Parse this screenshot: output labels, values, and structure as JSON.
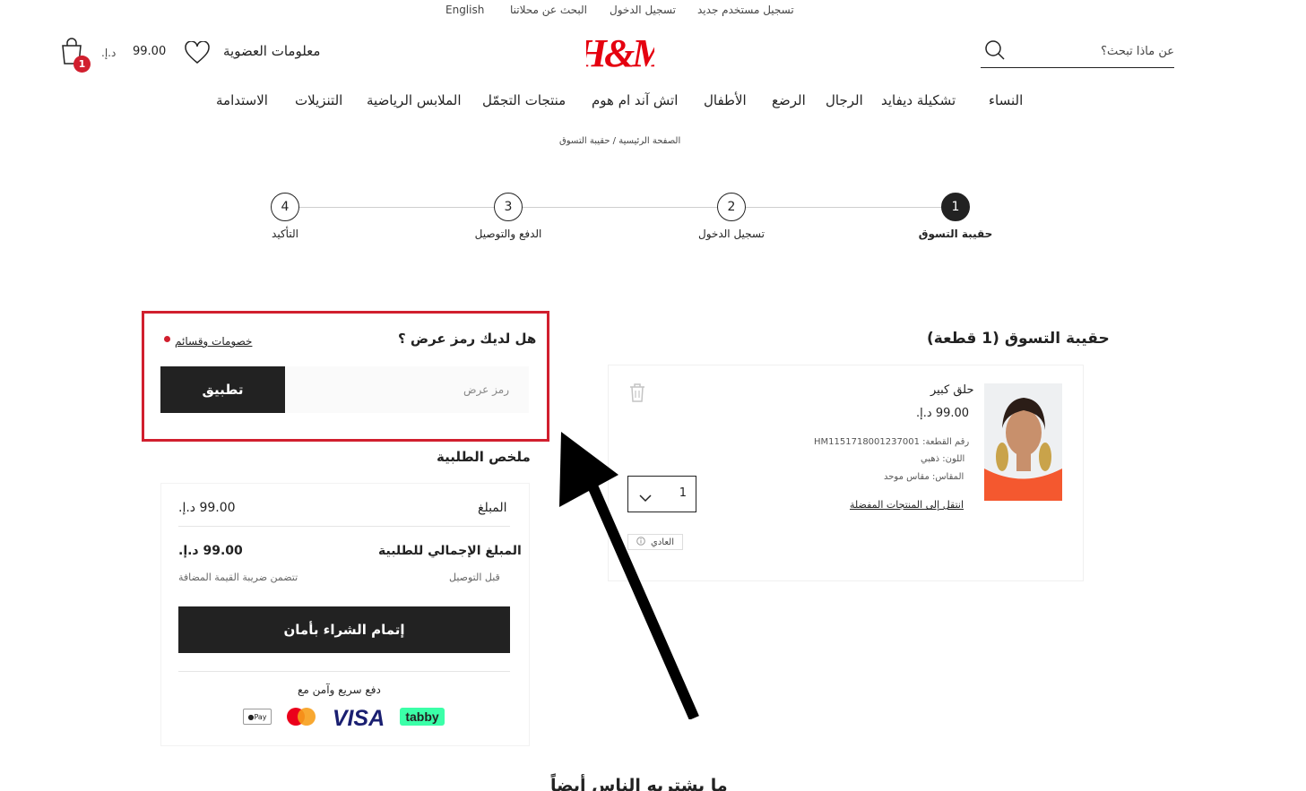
{
  "topbar": {
    "english": "English",
    "search_stores": "البحث عن محلاتنا",
    "sign_in": "تسجيل الدخول",
    "register": "تسجيل مستخدم جديد"
  },
  "header": {
    "logo": "H&M",
    "search_placeholder": "عن ماذا تبحث؟",
    "membership": "معلومات العضوية",
    "cart_total": "99.00",
    "currency": "د.إ.‏",
    "cart_count": "1"
  },
  "nav": [
    "النساء",
    "تشكيلة ديفايد",
    "الرجال",
    "الرضع",
    "الأطفال",
    "اتش آند ام هوم",
    "منتجات التجمّل",
    "الملابس الرياضية",
    "التنزيلات",
    "الاستدامة"
  ],
  "breadcrumb": "الصفحة الرئيسية / حقيبة التسوق",
  "stepper": {
    "steps": [
      {
        "num": "1",
        "label": "حقيبة التسوق"
      },
      {
        "num": "2",
        "label": "تسجيل الدخول"
      },
      {
        "num": "3",
        "label": "الدفع والتوصيل"
      },
      {
        "num": "4",
        "label": "التأكيد"
      }
    ],
    "active_step": 1
  },
  "promo": {
    "question": "هل لديك رمز عرض ؟",
    "discounts_link": "خصومات وقسائم",
    "input_placeholder": "رمز عرض",
    "apply": "تطبيق"
  },
  "summary": {
    "title": "ملخص الطلبية",
    "amount_label": "المبلغ",
    "amount_value": "99.00 د.إ.‏",
    "total_label": "المبلغ الإجمالي للطلبية",
    "total_value": "99.00 د.إ.‏",
    "before_delivery": "قبل التوصيل",
    "vat_note": "تتضمن ضريبة القيمة المضافة",
    "checkout": "إتمام الشراء بأمان",
    "fast_pay": "دفع سريع وآمن مع",
    "payment_methods": [
      "Apple Pay",
      "Mastercard",
      "VISA",
      "tabby"
    ]
  },
  "cart": {
    "title": "حقيبة التسوق (1 قطعة)",
    "item_name": "حلق كبير",
    "item_price": "99.00 د.إ.‏",
    "article_no": "رقم القطعة: HM1151718001237001",
    "color": "اللون: ذهبي",
    "size": "المقاس: مقاس موحد",
    "move_to_favourites": "انتقل إلى المنتجات المفضلة",
    "quantity": "1",
    "shipping_badge": "العادي"
  },
  "more_section_title": "ما يشتريه الناس أيضاً",
  "colors": {
    "brand_red": "#e50010",
    "highlight_red": "#d11f2e",
    "dark": "#222222",
    "tabby_green": "#3bffa8"
  }
}
